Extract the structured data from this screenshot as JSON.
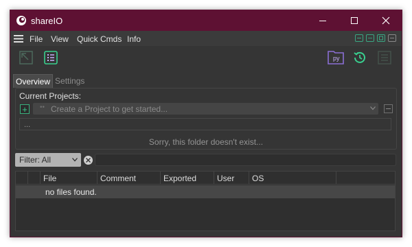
{
  "window": {
    "title": "shareIO"
  },
  "menu": {
    "items": [
      "File",
      "View",
      "Quick Cmds",
      "Info"
    ]
  },
  "toolbar": {
    "py_label": "py"
  },
  "tabs": [
    {
      "label": "Overview",
      "active": true
    },
    {
      "label": "Settings",
      "active": false
    }
  ],
  "projects": {
    "section_title": "Current Projects:",
    "add_label": "+",
    "combo_dots": "••",
    "combo_placeholder": "Create a Project to get started...",
    "path_value": "...",
    "status_message": "Sorry, this folder doesn't exist..."
  },
  "filter": {
    "selected": "Filter: All",
    "search_value": ""
  },
  "table": {
    "columns": [
      "",
      "File",
      "Comment",
      "Exported",
      "User",
      "OS",
      ""
    ],
    "empty_message": "no files found."
  },
  "colors": {
    "titlebar": "#5e1133",
    "accent_green": "#39d08f",
    "accent_purple": "#8b6fd6",
    "background": "#353535"
  }
}
